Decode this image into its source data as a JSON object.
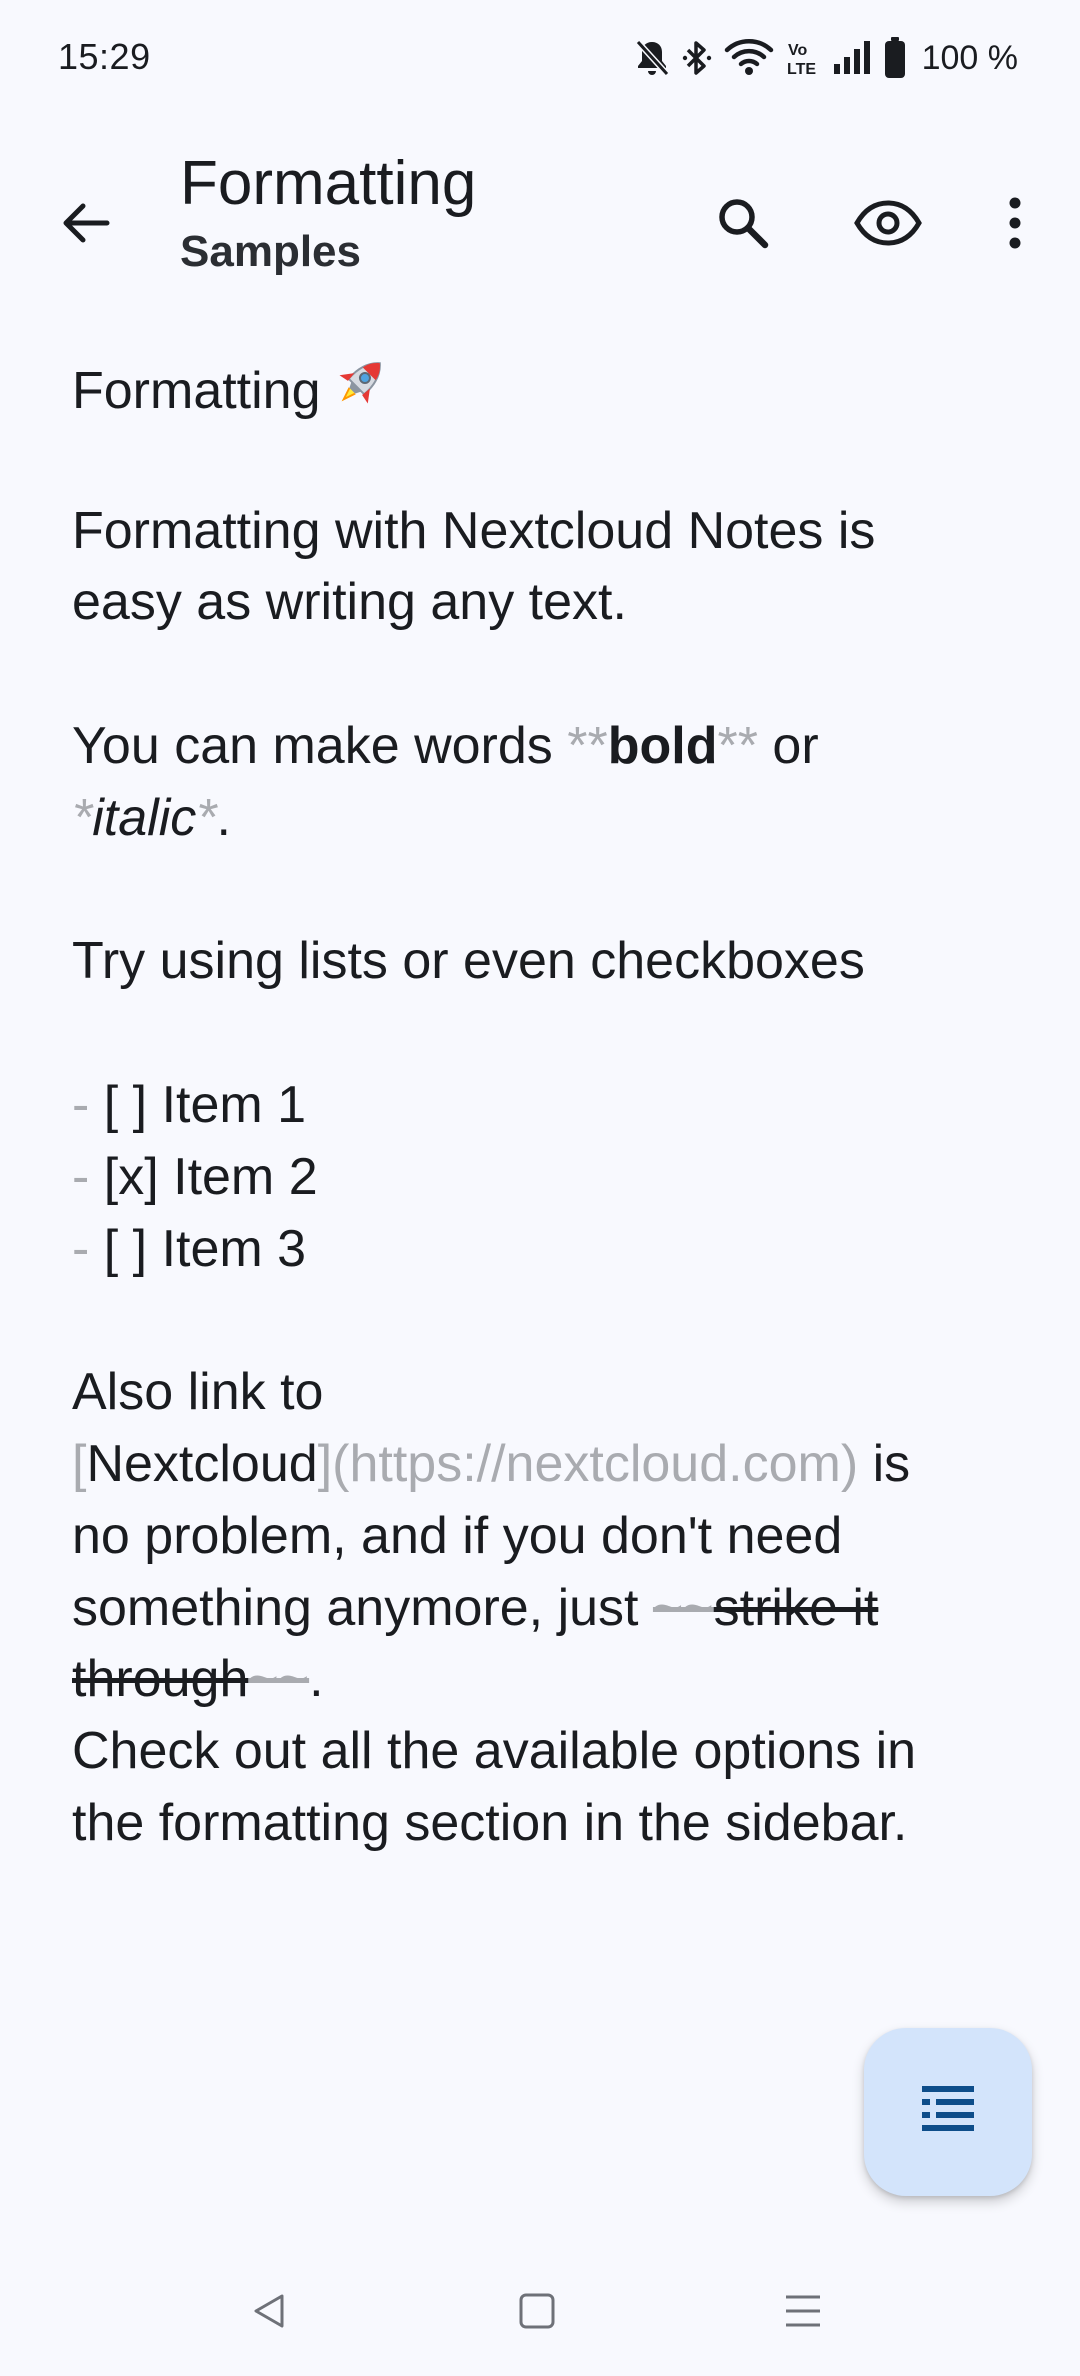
{
  "status_bar": {
    "time": "15:29",
    "battery": "100 %",
    "icons": [
      "bell-off-icon",
      "bluetooth-icon",
      "wifi-icon",
      "volte-icon",
      "signal-icon",
      "battery-icon"
    ]
  },
  "app_bar": {
    "title": "Formatting",
    "subtitle": "Samples",
    "icons": [
      "arrow-back-icon",
      "search-icon",
      "eye-icon",
      "more-vert-icon"
    ]
  },
  "note": {
    "heading": "Formatting",
    "heading_icon": "rocket-icon",
    "para1_line1": "Formatting with Nextcloud Notes is",
    "para1_line2": "easy as writing any text.",
    "para2_prefix": "You can make words ",
    "bold_marker": "**",
    "bold_word": "bold",
    "para2_or": " or",
    "italic_marker": "*",
    "italic_word": "italic",
    "period": ".",
    "para3": "Try using lists or even checkboxes",
    "list_marker": "-",
    "list_items": [
      " [ ] Item 1",
      " [x] Item 2",
      " [ ] Item 3"
    ],
    "para4_line1": "Also link to",
    "link_open": "[",
    "link_text": "Nextcloud",
    "link_close": "]",
    "link_url": "(https://nextcloud.com)",
    "para4_is": " is",
    "para4_line3": "no problem, and if you don't need",
    "para4_line4_prefix": "something anymore, just ",
    "strike_marker": "~~",
    "strike_part1": "strike it",
    "strike_part2": "through",
    "para5_line1": "Check out all the available options in",
    "para5_line2": "the formatting section in the sidebar."
  },
  "fab": {
    "icon": "format-toc-icon"
  },
  "nav_bar": {
    "icons": [
      "nav-back-icon",
      "nav-home-icon",
      "nav-recents-icon"
    ]
  },
  "colors": {
    "background": "#f8f9fe",
    "text": "#1a1c20",
    "markdown_marker": "#a9abb0",
    "fab_background": "#d3e4fb",
    "fab_icon": "#0d4d8a"
  }
}
